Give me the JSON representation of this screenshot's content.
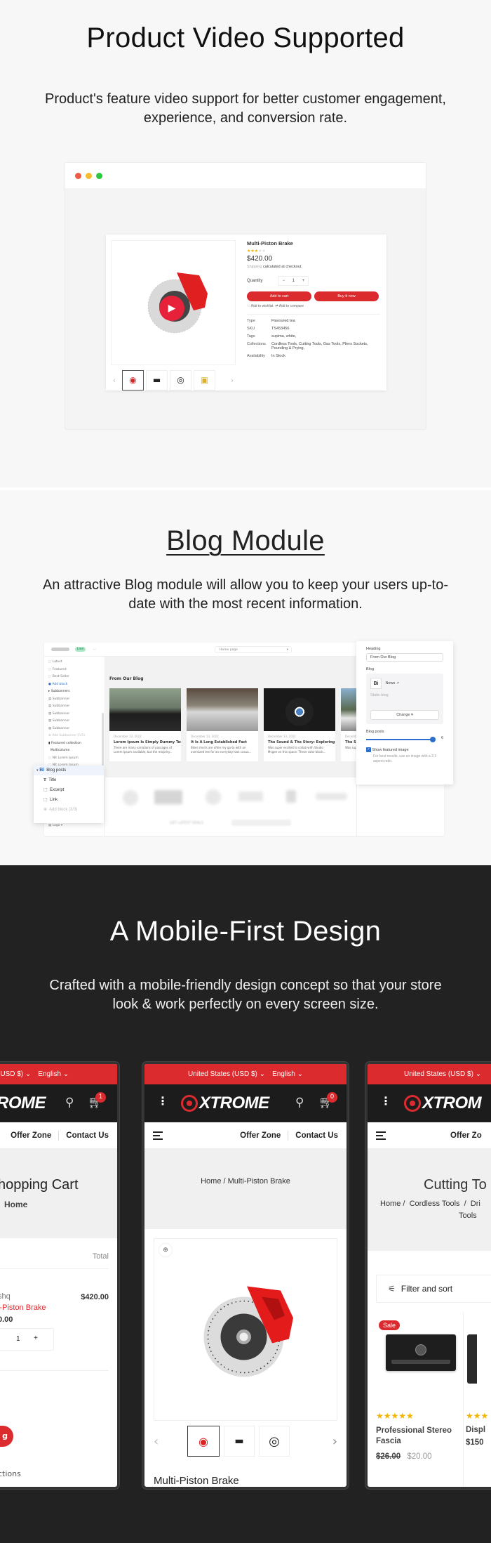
{
  "video_section": {
    "title": "Product Video Supported",
    "subtitle": "Product's feature video support for better customer engagement, experience, and conversion rate.",
    "window_dots": [
      "#ee5a45",
      "#f5bd2e",
      "#29c840"
    ],
    "product": {
      "name": "Multi-Piston Brake",
      "rating": 3,
      "rating_max": 5,
      "price": "$420.00",
      "shipping_link": "Shipping",
      "shipping_text": "calculated at checkout.",
      "quantity_label": "Quantity",
      "quantity_value": "1",
      "minus": "−",
      "plus": "+",
      "add_to_cart": "Add to cart",
      "buy_now": "Buy it now",
      "wishlist": "Add to wishlist",
      "compare": "Add to compare",
      "meta": [
        {
          "key": "Type",
          "value": "Flavoured tea"
        },
        {
          "key": "SKU",
          "value": "TS453456"
        },
        {
          "key": "Tags",
          "value": "supima, white,"
        },
        {
          "key": "Collections",
          "value": "Cordless Tools, Cutting Tools, Gas Tools, Pliers Sockets, Pounding & Prying,"
        },
        {
          "key": "Availability",
          "value": "In Stock"
        }
      ],
      "thumbnails": [
        "brake-thumb",
        "headlight-thumb",
        "tire-thumb",
        "engine-parts-thumb"
      ],
      "prev": "‹",
      "next": "›"
    }
  },
  "blog_section": {
    "title": "Blog Module",
    "subtitle": "An attractive Blog module will allow you to keep your users up-to-date with the most recent information.",
    "editor": {
      "status_badge": "Live",
      "more": "···",
      "page_select": "Home page",
      "sidebar_items": [
        "Latest",
        "Featured",
        "Best Seller",
        "Add block",
        "Subbanners",
        "Subbanner",
        "Subbanner",
        "Subbanner",
        "Subbanner",
        "Subbanner",
        "Add Subbanner (5/5)",
        "Featured collection",
        "Multicolumn",
        "Nit Lorem Ipsum",
        "Nit Lorem Ipsum"
      ],
      "sidebar_bottom": "Logo",
      "canvas_heading": "From Our Blog",
      "posts": [
        {
          "date": "December 13, 2022",
          "title": "Lorem Ipsum Is Simply Dummy Text",
          "excerpt": "There are many variations of passages of Lorem Ipsum available, but the majority..."
        },
        {
          "date": "December 13, 2022",
          "title": "It Is A Long Established Fact",
          "excerpt": "Biker shorts are often my go-to with an oversized tee for an everyday look casua..."
        },
        {
          "date": "December 13, 2022",
          "title": "The Sound & The Story: Exploring",
          "excerpt": "Was super excited to collab with Studio Mcgee on this space. These color block..."
        },
        {
          "date": "December",
          "title": "The Sou",
          "excerpt": "Was supe Mcgee o"
        }
      ],
      "newsletter": "GET LATEST DEALS",
      "popup": {
        "header": "Blog posts",
        "items": [
          "Title",
          "Excerpt",
          "Link"
        ],
        "add_block": "Add block (3/3)"
      },
      "settings": {
        "heading_label": "Heading",
        "heading_value": "From Our Blog",
        "blog_label": "Blog",
        "blog_name": "News",
        "blog_type": "Static blog",
        "change_button": "Change",
        "posts_label": "Blog posts",
        "posts_value": "6",
        "posts_fraction": 1.0,
        "show_image_label": "Show featured image",
        "show_image_checked": true,
        "show_image_help": "For best results, use an image with a 2:3 aspect ratio."
      }
    }
  },
  "mobile_section": {
    "title": "A Mobile-First Design",
    "subtitle": "Crafted with a mobile-friendly design concept so that your store look & work perfectly on every screen size.",
    "brand": "XTROME",
    "accent": "#dc2b2f",
    "currency": "United States (USD $)",
    "language": "English",
    "nav": [
      "Offer Zone",
      "Contact Us"
    ],
    "phone1": {
      "currency_partial": "(USD $)",
      "brand_partial": "ROME",
      "cart_count": "1",
      "title": "hopping Cart",
      "breadcrumb": "Home",
      "total_label": "Total",
      "vendor": "shq",
      "product": "i-Piston Brake",
      "unit_price": "0.00",
      "line_total": "$420.00",
      "qty": "1",
      "plus": "+",
      "checkout_partial": "g",
      "footer_partial": "ctions"
    },
    "phone2": {
      "cart_count": "0",
      "breadcrumb_home": "Home /",
      "breadcrumb_current": "Multi-Piston Brake",
      "product_title": "Multi-Piston Brake",
      "prev": "‹",
      "next": "›"
    },
    "phone3": {
      "brand_partial": "XTROM",
      "nav_partial": "Offer Zo",
      "title": "Cutting To",
      "breadcrumb_line1": "Home /  Cordless Tools  /  Dri",
      "breadcrumb_line2": "Tools",
      "filter": "Filter and sort",
      "products": [
        {
          "badge": "Sale",
          "rating": 5,
          "name": "Professional Stereo Fascia",
          "old_price": "$26.00",
          "price": "$20.00"
        },
        {
          "rating": 3,
          "name": "Displ",
          "price": "$150"
        }
      ]
    }
  }
}
